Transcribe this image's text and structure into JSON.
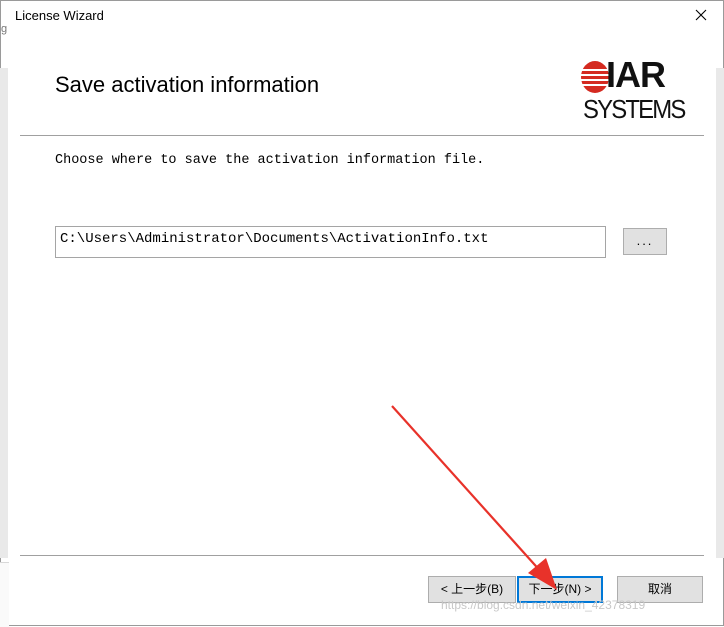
{
  "window": {
    "title": "License Wizard",
    "close_glyph": "✕"
  },
  "background": {
    "peek_char": "g"
  },
  "header": {
    "heading": "Save activation information",
    "logo": {
      "top": "IAR",
      "bottom": "SYSTEMS",
      "mark_color": "#d42a20"
    }
  },
  "body": {
    "instruction": "Choose where to save the activation information file.",
    "path_value": "C:\\Users\\Administrator\\Documents\\ActivationInfo.txt",
    "browse_label": "..."
  },
  "footer": {
    "back_label": "< 上一步(B)",
    "next_label": "下一步(N) >",
    "cancel_label": "取消"
  },
  "watermark": "https://blog.csdn.net/weixin_42378319",
  "colors": {
    "focus": "#0078d7",
    "annotation_arrow": "#e8322a"
  }
}
